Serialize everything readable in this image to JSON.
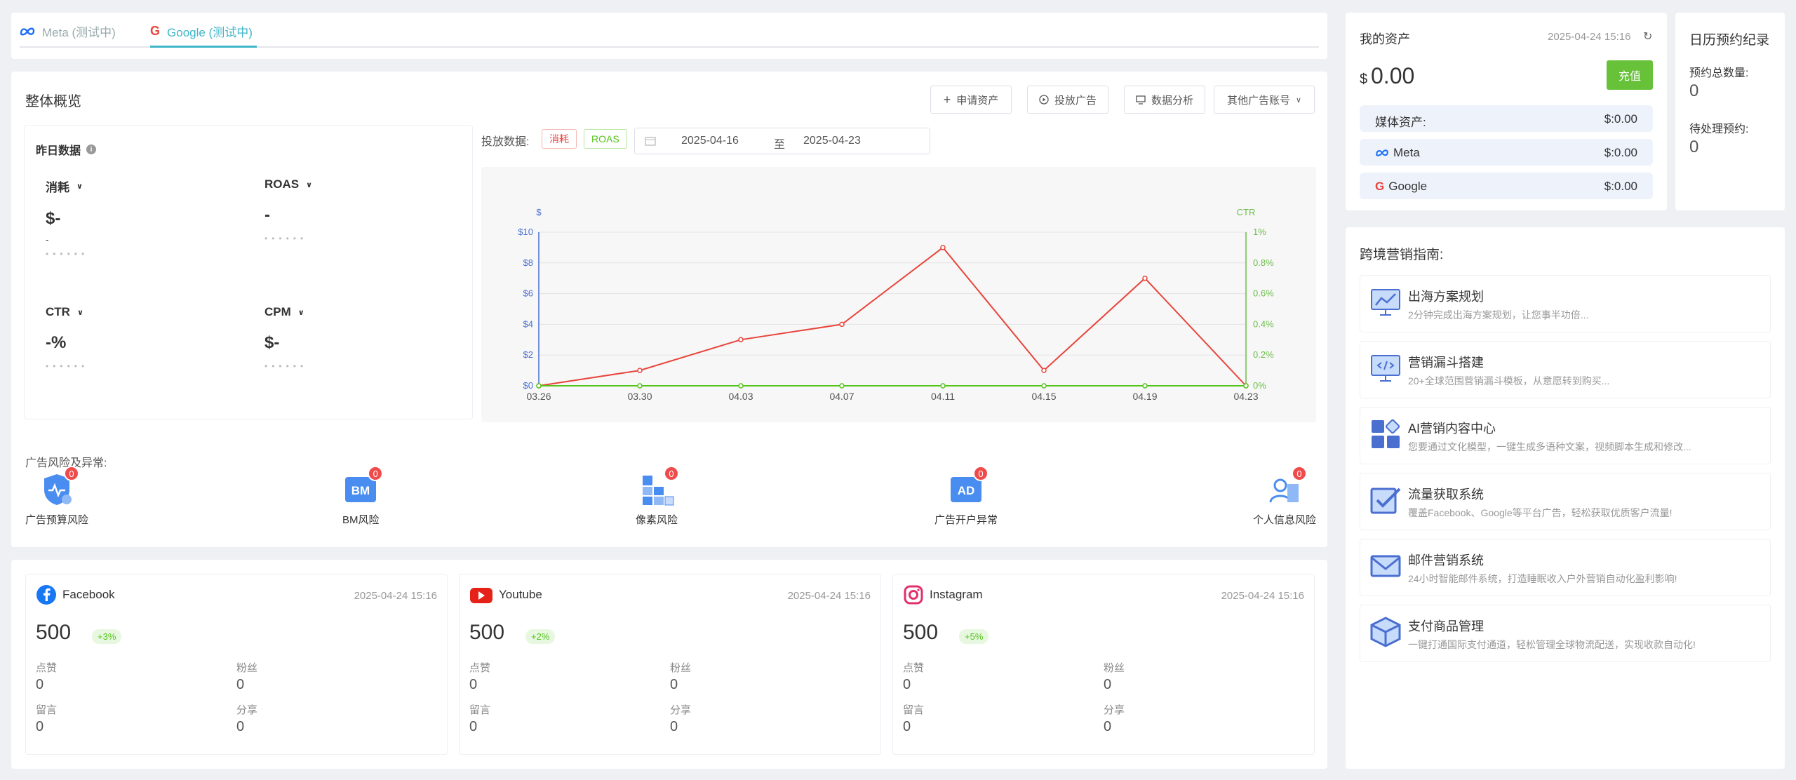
{
  "tabs": [
    {
      "label": "Meta (测试中)",
      "active": false
    },
    {
      "label": "Google (测试中)",
      "active": true
    }
  ],
  "overview": {
    "title": "整体概览",
    "buttons": {
      "apply": "申请资产",
      "ads": "投放广告",
      "analysis": "数据分析",
      "other": "其他广告账号"
    },
    "yesterday": {
      "title": "昨日数据",
      "metrics": [
        {
          "name": "消耗",
          "value": "$-",
          "sub": "-",
          "dots": "••••••"
        },
        {
          "name": "ROAS",
          "value": "-",
          "dots": "••••••"
        },
        {
          "name": "CTR",
          "value": "-%",
          "dots": "••••••"
        },
        {
          "name": "CPM",
          "value": "$-",
          "dots": "••••••"
        }
      ]
    },
    "delivery_label": "投放数据:",
    "tag_cost": "消耗",
    "tag_roas": "ROAS",
    "date_start": "2025-04-16",
    "date_sep": "至",
    "date_end": "2025-04-23",
    "risk_title": "广告风险及异常:",
    "risks": [
      {
        "label": "广告预算风险",
        "count": "0"
      },
      {
        "label": "BM风险",
        "count": "0",
        "icon_text": "BM"
      },
      {
        "label": "像素风险",
        "count": "0"
      },
      {
        "label": "广告开户异常",
        "count": "0",
        "icon_text": "AD"
      },
      {
        "label": "个人信息风险",
        "count": "0"
      }
    ]
  },
  "chart_data": {
    "type": "line",
    "categories": [
      "03.26",
      "03.30",
      "04.03",
      "04.07",
      "04.11",
      "04.15",
      "04.19",
      "04.23"
    ],
    "series": [
      {
        "values": [
          0,
          1,
          3,
          4,
          9,
          1,
          7,
          0
        ],
        "color": "#e8453c",
        "axis": "left"
      },
      {
        "values": [
          0,
          0,
          0,
          0,
          0,
          0,
          0,
          0
        ],
        "color": "#52c41a",
        "axis": "right"
      }
    ],
    "y_left": {
      "label": "$",
      "ticks": [
        "$0",
        "$2",
        "$4",
        "$6",
        "$8",
        "$10"
      ],
      "range": [
        0,
        10
      ]
    },
    "y_right": {
      "label": "CTR",
      "ticks": [
        "0%",
        "0.2%",
        "0.4%",
        "0.6%",
        "0.8%",
        "1%"
      ],
      "range": [
        0,
        1
      ]
    },
    "grid": true
  },
  "social": [
    {
      "name": "Facebook",
      "time": "2025-04-24 15:16",
      "value": "500",
      "pct": "+3%",
      "likes_label": "点赞",
      "likes": "0",
      "fans_label": "粉丝",
      "fans": "0",
      "comments_label": "留言",
      "comments": "0",
      "share_label": "分享",
      "share": "0"
    },
    {
      "name": "Youtube",
      "time": "2025-04-24 15:16",
      "value": "500",
      "pct": "+2%",
      "likes_label": "点赞",
      "likes": "0",
      "fans_label": "粉丝",
      "fans": "0",
      "comments_label": "留言",
      "comments": "0",
      "share_label": "分享",
      "share": "0"
    },
    {
      "name": "Instagram",
      "time": "2025-04-24 15:16",
      "value": "500",
      "pct": "+5%",
      "likes_label": "点赞",
      "likes": "0",
      "fans_label": "粉丝",
      "fans": "0",
      "comments_label": "留言",
      "comments": "0",
      "share_label": "分享",
      "share": "0"
    }
  ],
  "assets": {
    "title": "我的资产",
    "time": "2025-04-24 15:16",
    "currency": "$",
    "amount": "0.00",
    "recharge": "充值",
    "rows": [
      {
        "label": "媒体资产:",
        "value": "$:0.00"
      },
      {
        "label": "Meta",
        "value": "$:0.00"
      },
      {
        "label": "Google",
        "value": "$:0.00"
      }
    ]
  },
  "calendar": {
    "title": "日历预约纪录",
    "total_label": "预约总数量:",
    "total": "0",
    "pending_label": "待处理预约:",
    "pending": "0"
  },
  "guide": {
    "title": "跨境营销指南:",
    "items": [
      {
        "title": "出海方案规划",
        "desc": "2分钟完成出海方案规划，让您事半功倍..."
      },
      {
        "title": "营销漏斗搭建",
        "desc": "20+全球范围营销漏斗模板，从意愿转到购买..."
      },
      {
        "title": "AI营销内容中心",
        "desc": "您要通过文化模型，一键生成多语种文案，视频脚本生成和修改..."
      },
      {
        "title": "流量获取系统",
        "desc": "覆盖Facebook、Google等平台广告，轻松获取优质客户流量!"
      },
      {
        "title": "邮件营销系统",
        "desc": "24小时智能邮件系统，打造睡眠收入户外营销自动化盈利影响!"
      },
      {
        "title": "支付商品管理",
        "desc": "一键打通国际支付通道，轻松管理全球物流配送，实现收款自动化!"
      }
    ]
  }
}
